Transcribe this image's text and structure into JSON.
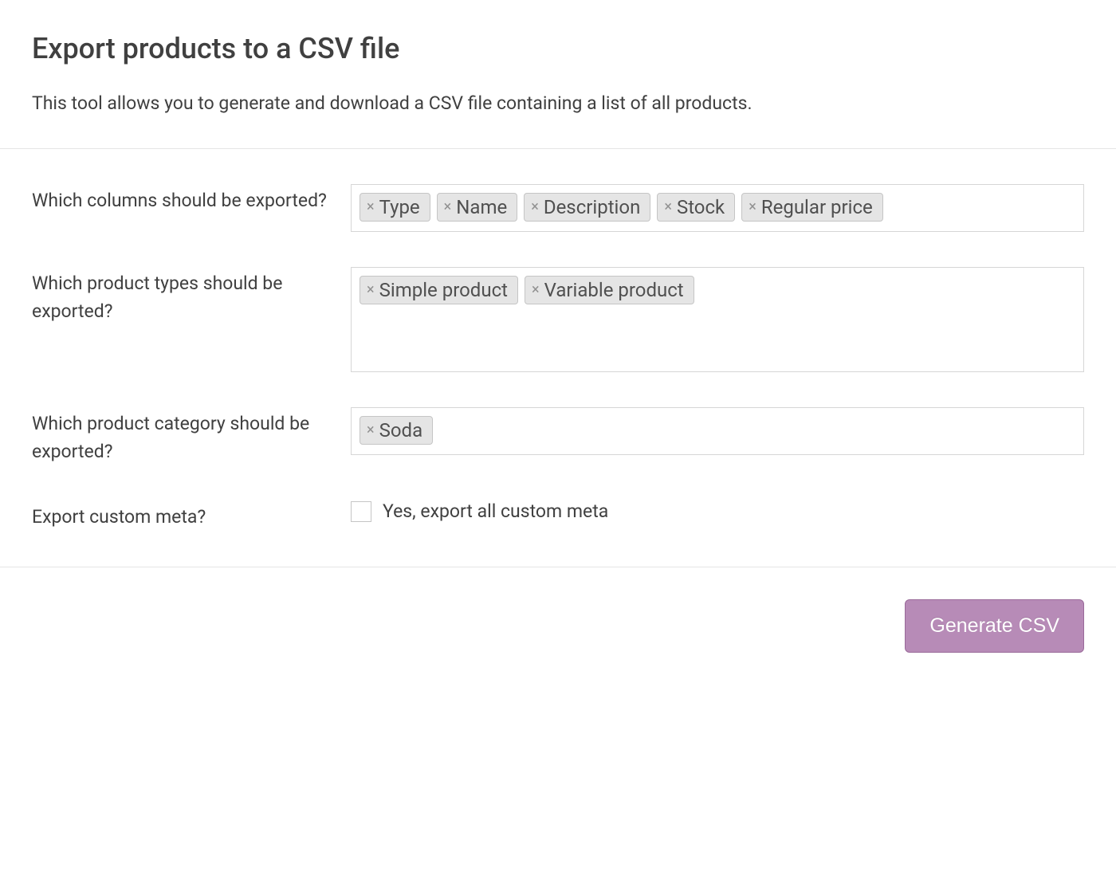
{
  "header": {
    "title": "Export products to a CSV file",
    "description": "This tool allows you to generate and download a CSV file containing a list of all products."
  },
  "form": {
    "columns": {
      "label": "Which columns should be exported?",
      "tags": [
        "Type",
        "Name",
        "Description",
        "Stock",
        "Regular price"
      ]
    },
    "product_types": {
      "label": "Which product types should be exported?",
      "tags": [
        "Simple product",
        "Variable product"
      ]
    },
    "category": {
      "label": "Which product category should be exported?",
      "tags": [
        "Soda"
      ]
    },
    "custom_meta": {
      "label": "Export custom meta?",
      "checkbox_label": "Yes, export all custom meta",
      "checked": false
    }
  },
  "footer": {
    "generate_button": "Generate CSV"
  },
  "icons": {
    "remove": "×"
  }
}
